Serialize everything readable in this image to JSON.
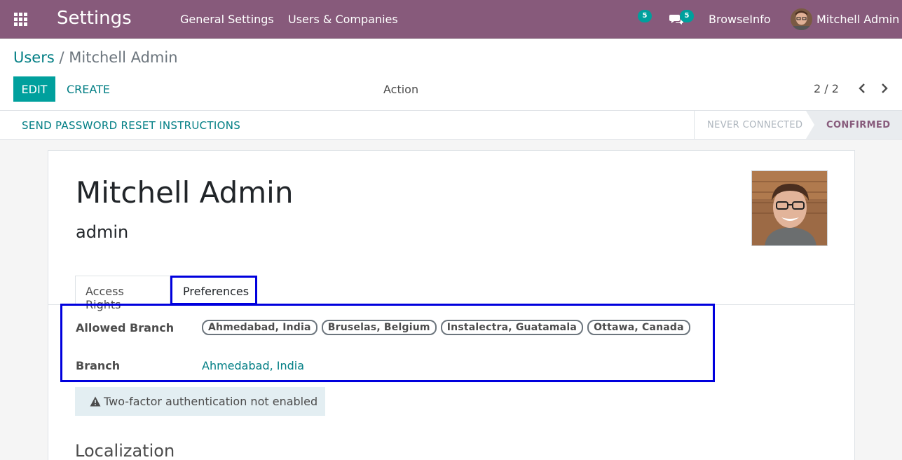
{
  "navbar": {
    "title": "Settings",
    "menu": [
      "General Settings",
      "Users & Companies"
    ],
    "activities_count": "5",
    "messages_count": "5",
    "company": "BrowseInfo",
    "user": "Mitchell Admin"
  },
  "breadcrumb": {
    "parent": "Users",
    "separator": "/",
    "current": "Mitchell Admin"
  },
  "toolbar": {
    "edit_label": "EDIT",
    "create_label": "CREATE",
    "action_label": "Action",
    "pager": "2 / 2"
  },
  "statusbar": {
    "reset_label": "SEND PASSWORD RESET INSTRUCTIONS",
    "stages": [
      "NEVER CONNECTED",
      "CONFIRMED"
    ],
    "active_stage": "CONFIRMED"
  },
  "record": {
    "name": "Mitchell Admin",
    "login": "admin"
  },
  "tabs": [
    {
      "label": "Access Rights",
      "active": false
    },
    {
      "label": "Preferences",
      "active": true
    }
  ],
  "preferences": {
    "allowed_branch_label": "Allowed Branch",
    "allowed_branches": [
      "Ahmedabad, India",
      "Bruselas, Belgium",
      "Instalectra, Guatamala",
      "Ottawa, Canada"
    ],
    "branch_label": "Branch",
    "branch_value": "Ahmedabad, India"
  },
  "twofa_notice": "Two-factor authentication not enabled",
  "section_title": "Localization",
  "colors": {
    "brand": "#875a7b",
    "primary": "#00a09d",
    "link": "#017e84",
    "highlight": "#0000dd"
  }
}
